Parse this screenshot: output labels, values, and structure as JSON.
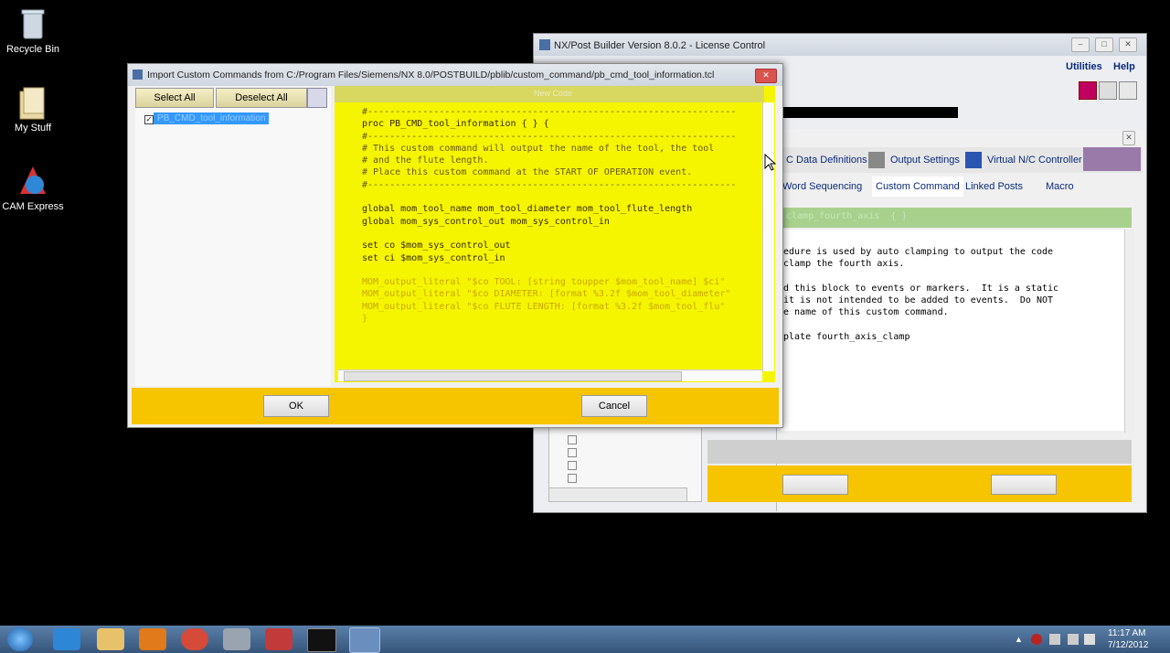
{
  "desktop": {
    "icons": [
      {
        "label": "Recycle Bin"
      },
      {
        "label": "My Stuff"
      },
      {
        "label": "CAM Express"
      }
    ]
  },
  "license_window": {
    "title": "NX/Post Builder Version 8.0.2 - License Control",
    "menu": {
      "utilities": "Utilities",
      "help": "Help"
    },
    "tabs": [
      "C Data Definitions",
      "Output Settings",
      "Virtual N/C Controller"
    ],
    "subtabs": [
      "Word Sequencing",
      "Custom Command",
      "Linked Posts",
      "Macro"
    ],
    "header_text": "clamp_fourth_axis  { }",
    "code_lines": [
      "edure is used by auto clamping to output the code",
      "clamp the fourth axis.",
      "",
      "d this block to events or markers.  It is a static",
      "it is not intended to be added to events.  Do NOT",
      "e name of this custom command.",
      "",
      "plate fourth_axis_clamp"
    ]
  },
  "import_dialog": {
    "title": "Import Custom Commands from  C:/Program Files/Siemens/NX 8.0/POSTBUILD/pblib/custom_command/pb_cmd_tool_information.tcl",
    "select_all": "Select All",
    "deselect_all": "Deselect All",
    "tree_item": "PB_CMD_tool_information",
    "code_header": "New Code",
    "code_lines": [
      "#-------------------------------------------------------------------",
      "proc PB_CMD_tool_information { } {",
      "#-------------------------------------------------------------------",
      "# This custom command will output the name of the tool, the tool",
      "# and the flute length.",
      "# Place this custom command at the START OF OPERATION event.",
      "#-------------------------------------------------------------------",
      "",
      "global mom_tool_name mom_tool_diameter mom_tool_flute_length",
      "global mom_sys_control_out mom_sys_control_in",
      "",
      "set co $mom_sys_control_out",
      "set ci $mom_sys_control_in",
      "",
      "MOM_output_literal \"$co TOOL: [string toupper $mom_tool_name] $ci\"",
      "MOM_output_literal \"$co DIAMETER: [format %3.2f $mom_tool_diameter\"",
      "MOM_output_literal \"$co FLUTE LENGTH: [format %3.2f $mom_tool_flu\"",
      "}"
    ],
    "ok": "OK",
    "cancel": "Cancel"
  },
  "taskbar": {
    "clock_time": "11:17 AM",
    "clock_date": "7/12/2012"
  },
  "colors": {
    "yellow": "#f5f500",
    "gold_bar": "#f7c400",
    "green_header": "#a9d18e",
    "selection": "#3399ff"
  }
}
